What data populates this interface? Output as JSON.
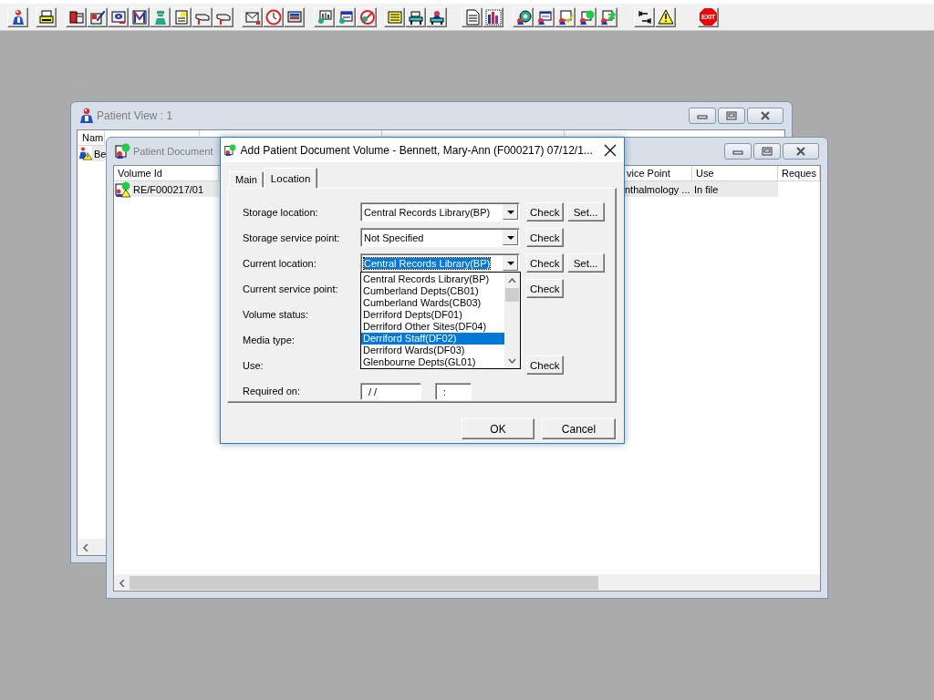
{
  "toolbar": {
    "exit_sign": "EXIT"
  },
  "patient_view": {
    "title": "Patient View : 1",
    "columns": [
      "Nam"
    ],
    "rows": [
      {
        "cells": [
          "Be"
        ],
        "selected": true
      }
    ]
  },
  "patient_documents": {
    "title": "Patient Document",
    "columns": [
      "Volume Id",
      "vice Point",
      "Use",
      "Reques"
    ],
    "rows": [
      {
        "cells": [
          "RE/F000217/01",
          "nthalmology ...",
          "In file"
        ],
        "selected": true
      }
    ]
  },
  "dialog": {
    "title": "Add Patient Document Volume - Bennett, Mary-Ann (F000217) 07/12/1...",
    "tabs": [
      {
        "label": "Main",
        "selected": false
      },
      {
        "label": "Location",
        "selected": true
      }
    ],
    "fields": [
      {
        "label": "Storage location:",
        "kind": "combo",
        "value": "Central Records Library(BP)",
        "highlighted": false,
        "buttons": [
          "Check",
          "Set..."
        ]
      },
      {
        "label": "Storage service point:",
        "kind": "combo",
        "value": "Not Specified",
        "highlighted": false,
        "buttons": [
          "Check"
        ]
      },
      {
        "label": "Current location:",
        "kind": "combo",
        "value": "Central Records Library(BP)",
        "highlighted": true,
        "buttons": [
          "Check",
          "Set..."
        ]
      },
      {
        "label": "Current service point:",
        "kind": "covered",
        "buttons": [
          "Check"
        ]
      },
      {
        "label": "Volume status:",
        "kind": "covered"
      },
      {
        "label": "Media type:",
        "kind": "covered"
      },
      {
        "label": "Use:",
        "kind": "covered",
        "buttons": [
          "Check"
        ]
      },
      {
        "label": "Required on:",
        "kind": "date",
        "date": "/ /",
        "time": ":"
      }
    ],
    "dropdown": {
      "items": [
        {
          "label": "Central Records Library(BP)",
          "selected": false
        },
        {
          "label": "Cumberland Depts(CB01)",
          "selected": false
        },
        {
          "label": "Cumberland Wards(CB03)",
          "selected": false
        },
        {
          "label": "Derriford Depts(DF01)",
          "selected": false
        },
        {
          "label": "Derriford Other Sites(DF04)",
          "selected": false
        },
        {
          "label": "Derriford Staff(DF02)",
          "selected": true
        },
        {
          "label": "Derriford Wards(DF03)",
          "selected": false
        },
        {
          "label": "Glenbourne Depts(GL01)",
          "selected": false
        }
      ]
    },
    "buttons": [
      "OK",
      "Cancel"
    ]
  }
}
